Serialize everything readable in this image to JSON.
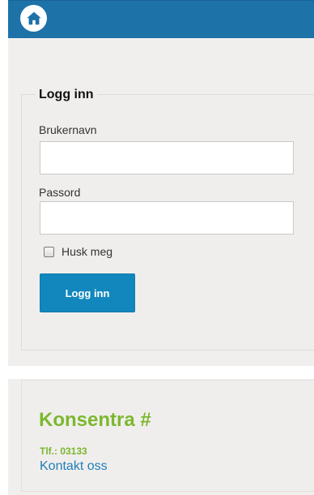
{
  "header": {
    "home_icon": "home-icon",
    "bar_color": "#1d72a8"
  },
  "login": {
    "legend": "Logg inn",
    "username_label": "Brukernavn",
    "username_value": "",
    "password_label": "Passord",
    "password_value": "",
    "remember_label": "Husk meg",
    "remember_checked": false,
    "submit_label": "Logg inn",
    "button_color": "#1287be"
  },
  "contact": {
    "brand_name": "Konsentra #",
    "phone": "Tlf.: 03133",
    "link_label": "Kontakt oss",
    "brand_color": "#7cb82f"
  }
}
